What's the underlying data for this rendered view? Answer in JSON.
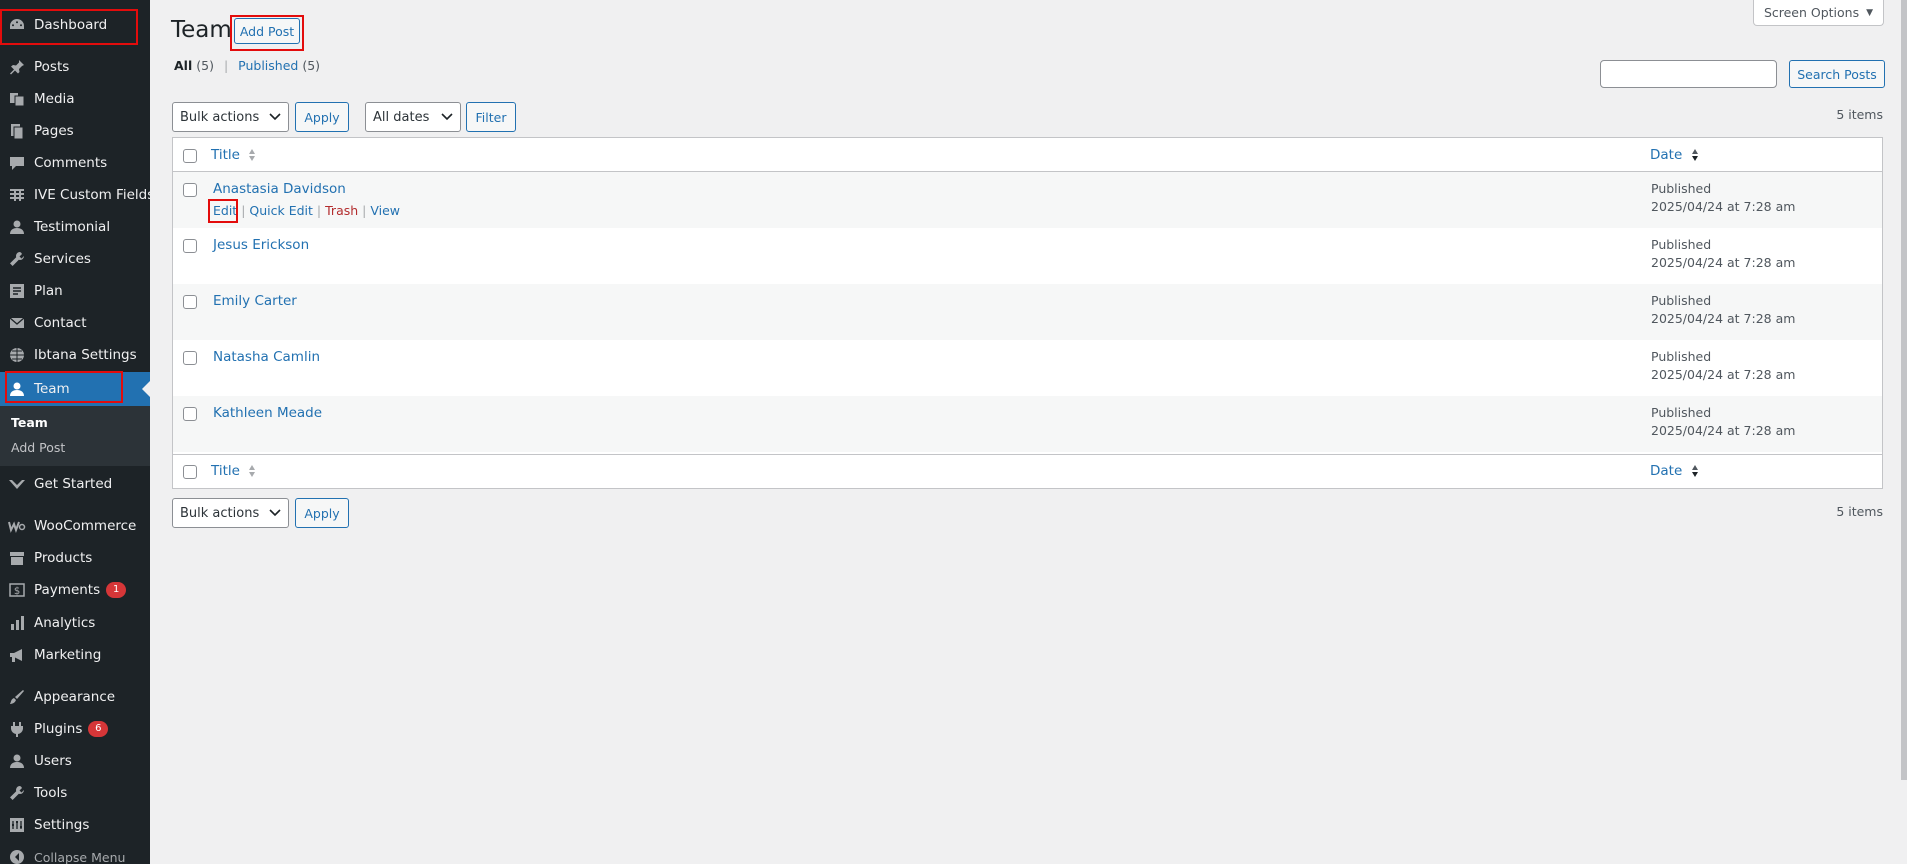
{
  "sidebar": {
    "items": [
      {
        "label": "Dashboard",
        "icon": "dashboard-icon"
      },
      {
        "label": "Posts",
        "icon": "pushpin-icon"
      },
      {
        "label": "Media",
        "icon": "media-icon"
      },
      {
        "label": "Pages",
        "icon": "pages-icon"
      },
      {
        "label": "Comments",
        "icon": "comment-icon"
      },
      {
        "label": "IVE Custom Fields",
        "icon": "grid-icon"
      },
      {
        "label": "Testimonial",
        "icon": "user-icon"
      },
      {
        "label": "Services",
        "icon": "wrench-icon"
      },
      {
        "label": "Plan",
        "icon": "document-icon"
      },
      {
        "label": "Contact",
        "icon": "envelope-icon"
      },
      {
        "label": "Ibtana Settings",
        "icon": "globe-icon"
      },
      {
        "label": "Team",
        "icon": "user-icon"
      },
      {
        "label": "Get Started",
        "icon": "chevron-logo-icon"
      },
      {
        "label": "WooCommerce",
        "icon": "woo-icon"
      },
      {
        "label": "Products",
        "icon": "archive-icon"
      },
      {
        "label": "Payments",
        "icon": "dollar-icon",
        "badge": "1"
      },
      {
        "label": "Analytics",
        "icon": "bar-chart-icon"
      },
      {
        "label": "Marketing",
        "icon": "megaphone-icon"
      },
      {
        "label": "Appearance",
        "icon": "paintbrush-icon"
      },
      {
        "label": "Plugins",
        "icon": "plugin-icon",
        "badge": "6"
      },
      {
        "label": "Users",
        "icon": "user-icon"
      },
      {
        "label": "Tools",
        "icon": "wrench-icon"
      },
      {
        "label": "Settings",
        "icon": "settings-icon"
      },
      {
        "label": "Collapse Menu",
        "icon": "collapse-icon"
      }
    ],
    "submenu": [
      {
        "label": "Team"
      },
      {
        "label": "Add Post"
      }
    ]
  },
  "header": {
    "title": "Team",
    "add_post": "Add Post",
    "screen_options": "Screen Options"
  },
  "filters": {
    "all_label": "All",
    "all_count": "(5)",
    "separator": "|",
    "published_label": "Published",
    "published_count": "(5)"
  },
  "search": {
    "button": "Search Posts",
    "value": ""
  },
  "toolbar": {
    "bulk_actions": "Bulk actions",
    "apply": "Apply",
    "all_dates": "All dates",
    "filter": "Filter",
    "items_count": "5 items"
  },
  "table": {
    "columns": {
      "title": "Title",
      "date": "Date"
    },
    "row_actions": {
      "edit": "Edit",
      "quick_edit": "Quick Edit",
      "trash": "Trash",
      "view": "View",
      "sep": "|"
    },
    "rows": [
      {
        "title": "Anastasia Davidson",
        "status": "Published",
        "date": "2025/04/24 at 7:28 am"
      },
      {
        "title": "Jesus Erickson",
        "status": "Published",
        "date": "2025/04/24 at 7:28 am"
      },
      {
        "title": "Emily Carter",
        "status": "Published",
        "date": "2025/04/24 at 7:28 am"
      },
      {
        "title": "Natasha Camlin",
        "status": "Published",
        "date": "2025/04/24 at 7:28 am"
      },
      {
        "title": "Kathleen Meade",
        "status": "Published",
        "date": "2025/04/24 at 7:28 am"
      }
    ]
  },
  "colors": {
    "sidebar_bg": "#1d2327",
    "accent": "#2271b1",
    "highlight_box": "#e30c0c",
    "trash": "#b32d2e",
    "badge": "#d63638"
  }
}
